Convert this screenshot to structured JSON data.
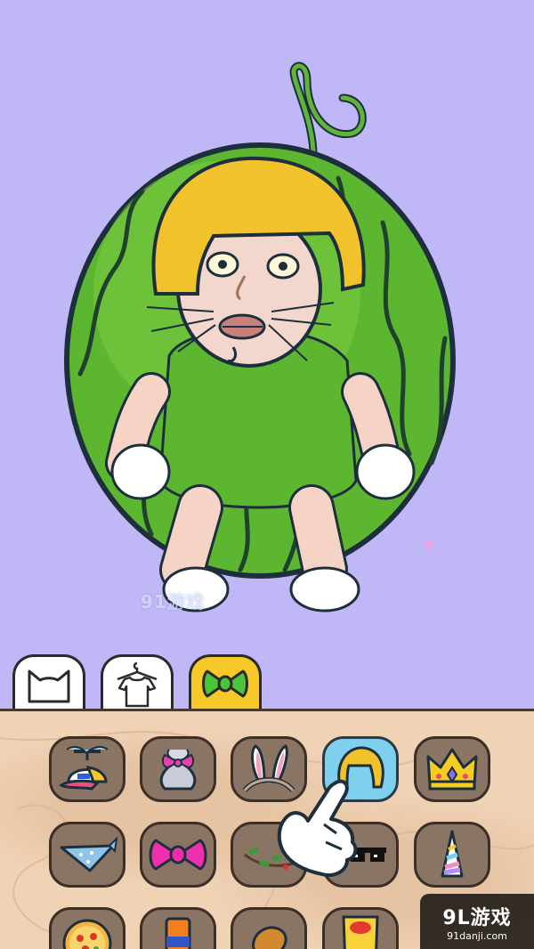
{
  "watermark": {
    "text": "91游戏"
  },
  "tabs": [
    {
      "id": "face",
      "icon": "cat-face-icon",
      "active": false
    },
    {
      "id": "clothes",
      "icon": "shirt-on-hanger-icon",
      "active": false
    },
    {
      "id": "accessories",
      "icon": "green-bow-icon",
      "active": true
    }
  ],
  "items": [
    {
      "icon": "propeller-cap-icon"
    },
    {
      "icon": "pink-bow-bag-icon"
    },
    {
      "icon": "bunny-ears-headband-icon"
    },
    {
      "icon": "blonde-wig-icon",
      "selected": true
    },
    {
      "icon": "gold-crown-icon"
    },
    {
      "icon": "blue-bandana-icon"
    },
    {
      "icon": "pink-bow-icon"
    },
    {
      "icon": "leaf-wreath-icon"
    },
    {
      "icon": "pixel-sunglasses-icon"
    },
    {
      "icon": "unicorn-horn-icon"
    },
    {
      "icon": "pizza-icon"
    },
    {
      "icon": "fanta-can-icon"
    },
    {
      "icon": "chicken-leg-icon"
    },
    {
      "icon": "lays-chips-icon"
    }
  ],
  "brand": {
    "title": "9L游戏",
    "url": "91danji.com"
  },
  "colors": {
    "background": "#c0b7f7",
    "panel": "#f0d2b5",
    "slot": "#8a7565",
    "selected_slot": "#7fd0ef",
    "active_tab": "#f7c928"
  }
}
